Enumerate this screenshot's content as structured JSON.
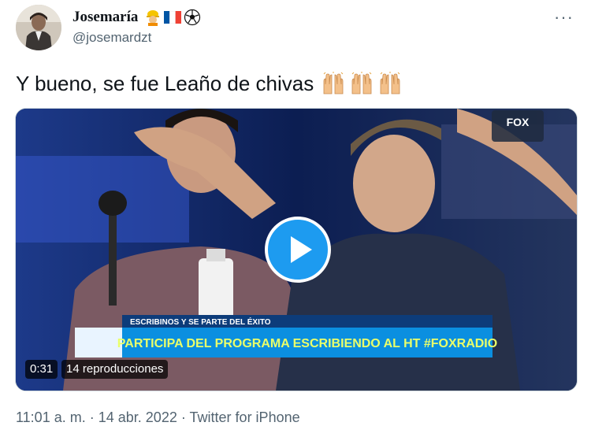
{
  "author": {
    "display_name": "Josemaría",
    "handle": "@josemardzt",
    "name_emojis": [
      "construction-worker-emoji",
      "france-flag-emoji",
      "soccer-ball-emoji"
    ]
  },
  "menu": {
    "more_label": "···"
  },
  "tweet": {
    "text": "Y bueno, se fue Leaño de chivas",
    "emojis": [
      "raising-hands-emoji",
      "raising-hands-emoji",
      "raising-hands-emoji"
    ]
  },
  "video": {
    "duration": "0:31",
    "views": "14 reproducciones",
    "channel_logo": "FOX",
    "banner_top": "ESCRIBINOS Y SE PARTE DEL ÉXITO",
    "banner_main": "PARTICIPA DEL PROGRAMA ESCRIBIENDO AL HT #FOXRADIO"
  },
  "meta": {
    "time": "11:01 a. m.",
    "separator": "·",
    "date": "14 abr. 2022",
    "source": "Twitter for iPhone"
  },
  "colors": {
    "text_primary": "#0f1419",
    "text_secondary": "#536471",
    "play_button": "#1d9bf0",
    "banner": "#0b8fe0"
  }
}
